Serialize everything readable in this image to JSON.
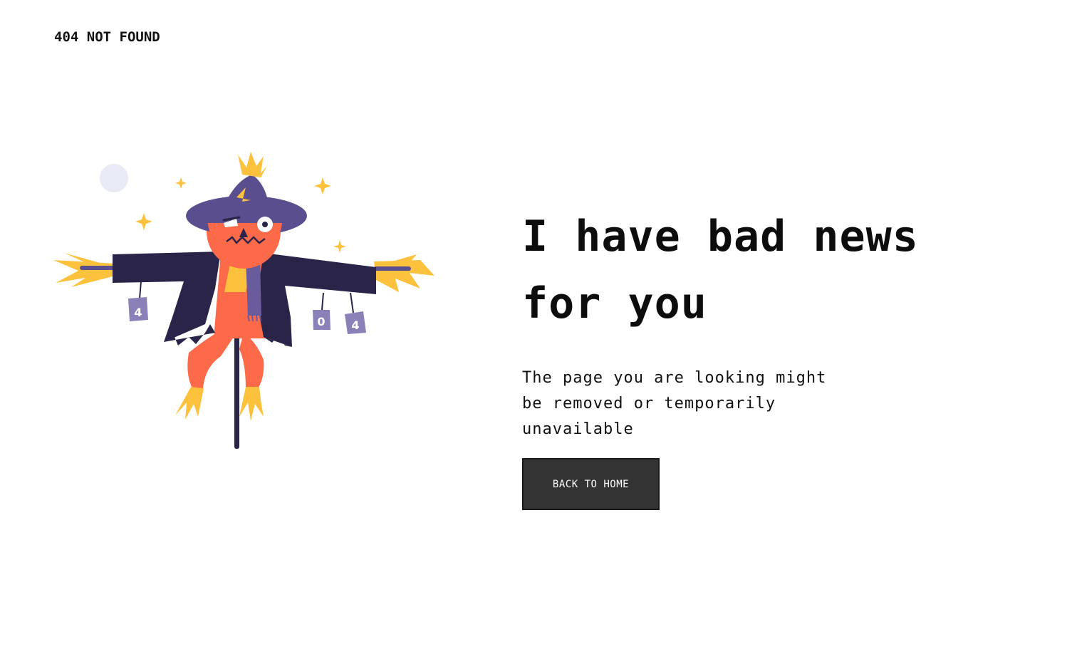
{
  "header": {
    "brand": "404 NOT FOUND"
  },
  "illustration": {
    "name": "scarecrow",
    "can_labels": [
      "4",
      "0",
      "4"
    ],
    "colors": {
      "hat": "#5b4e8e",
      "coat": "#2b2449",
      "face": "#fd6a4a",
      "straw": "#fcc23e",
      "scarf": "#6a5c9c",
      "moon": "#e8ebf5",
      "sparkle": "#fcc23e"
    }
  },
  "main": {
    "headline": "I have bad news for you",
    "description": "The page you are looking might be removed or temporarily unavailable",
    "button_label": "BACK TO HOME"
  },
  "colors": {
    "background": "#ffffff",
    "text": "#111111",
    "button_bg": "#333333",
    "button_text": "#ffffff"
  }
}
